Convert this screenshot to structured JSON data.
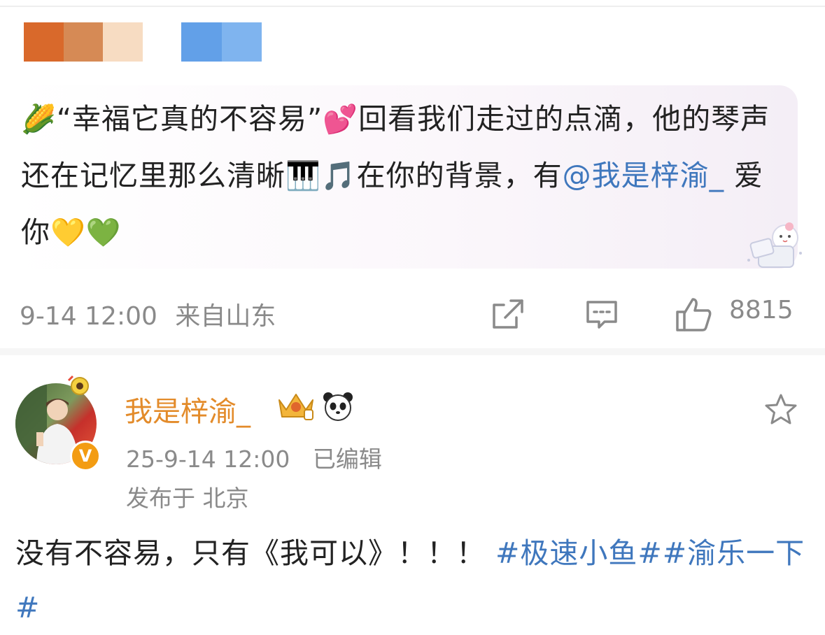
{
  "post": {
    "censor_colors": [
      "#d9692b",
      "#d68a55",
      "#f7dcc2",
      "#62a0e8",
      "#7fb4ef"
    ],
    "text_part1": "“幸福它真的不容易”",
    "text_part2": "回看我们走过的点滴，他的琴声还在记忆里那么清晰",
    "text_part3": "在你的背景，有",
    "mention": "@我是梓渝_",
    "text_part4": " 爱你",
    "emoji_corn": "🌽",
    "emoji_hearts": "💕",
    "emoji_piano": "🎹",
    "emoji_note": "🎵",
    "emoji_yellow_heart": "💛",
    "emoji_green_heart": "💚",
    "time": "9-14 12:00",
    "source": "来自山东",
    "like_count": "8815",
    "icons": [
      "share-icon",
      "comment-icon",
      "like-icon"
    ]
  },
  "comment": {
    "username": "我是梓渝_",
    "verified_badge": "V",
    "time": "25-9-14 12:00",
    "edited": "已编辑",
    "location": "发布于 北京",
    "text_plain": "没有不容易，只有《我可以》！！！",
    "hashtag1": "#极速小鱼#",
    "hashtag2": "#渝乐一下#",
    "icons": [
      "crown-icon",
      "panda-icon",
      "star-icon"
    ]
  }
}
